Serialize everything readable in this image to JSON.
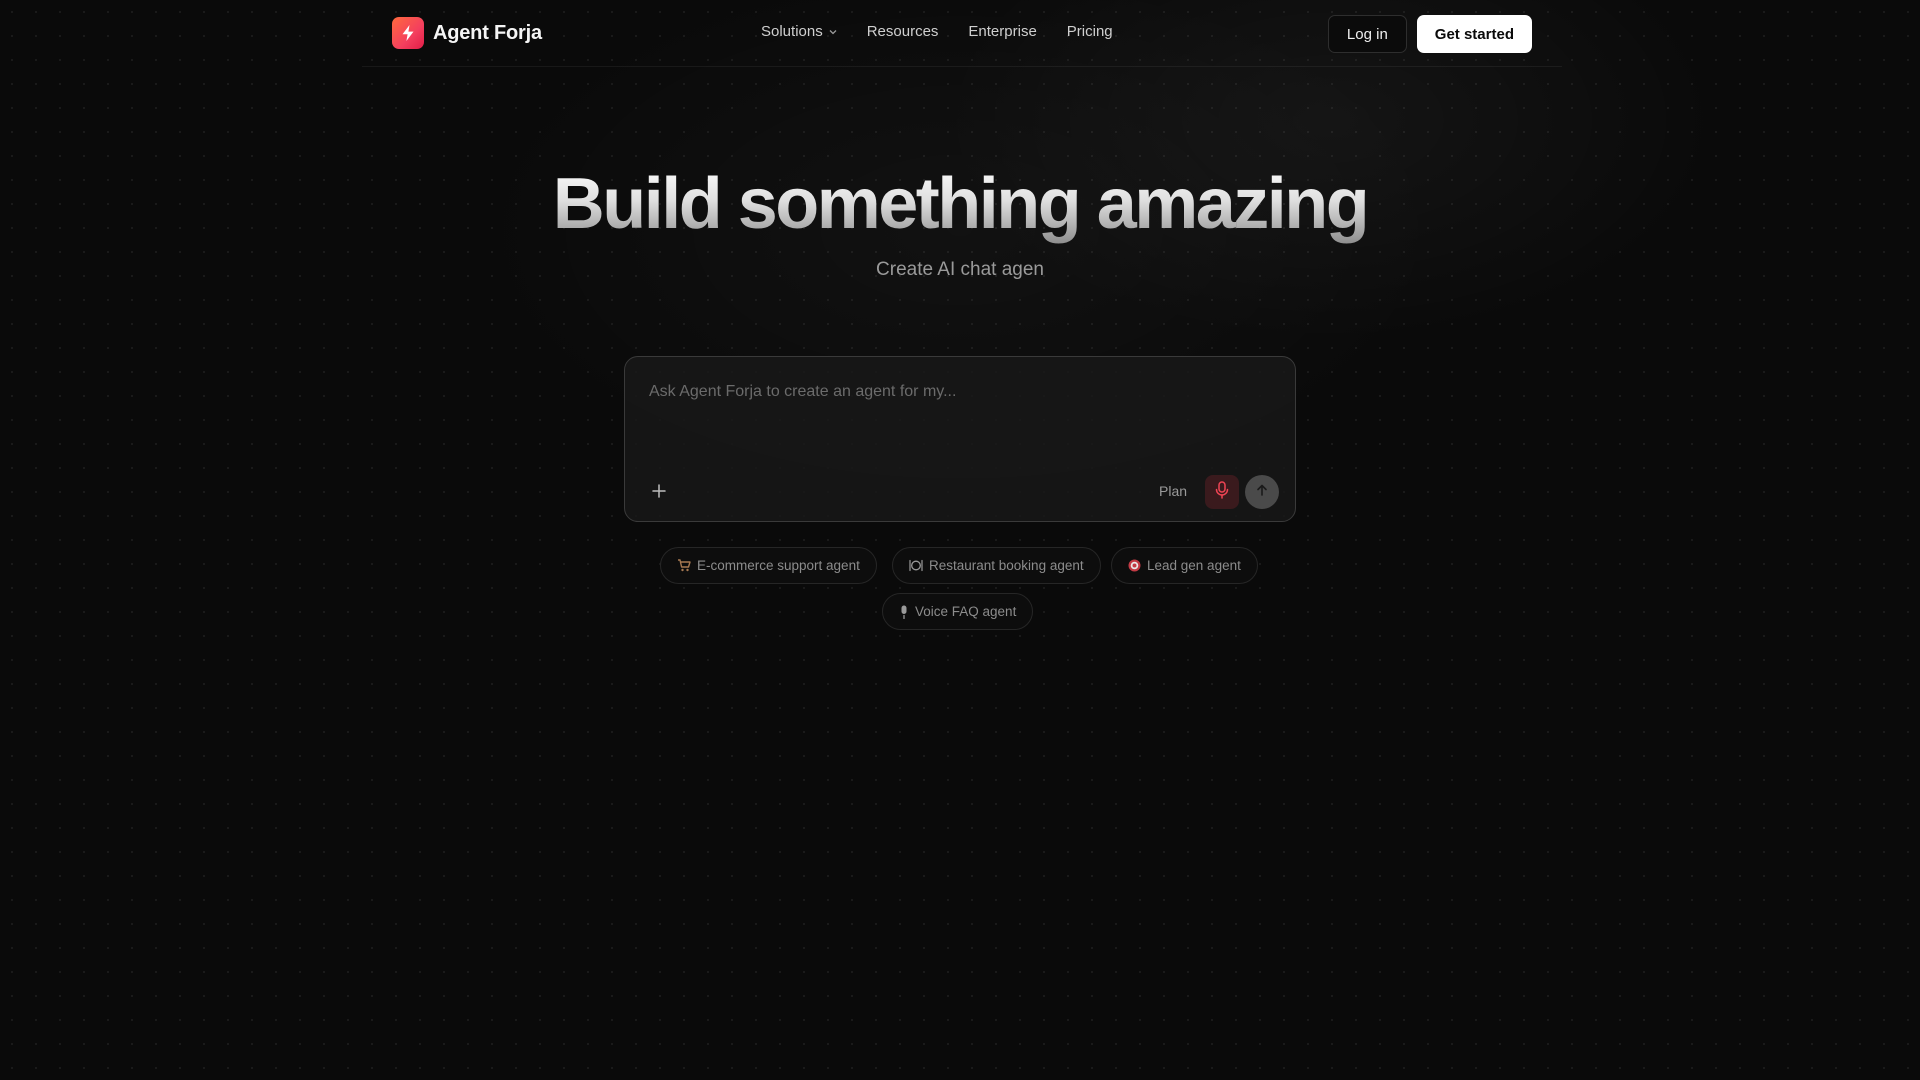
{
  "brand": {
    "name": "Agent Forja",
    "accent": "#f43f5e"
  },
  "nav": {
    "items": [
      {
        "label": "Solutions",
        "has_dropdown": true
      },
      {
        "label": "Resources"
      },
      {
        "label": "Enterprise"
      },
      {
        "label": "Pricing"
      }
    ]
  },
  "header_actions": {
    "login_label": "Log in",
    "signup_label": "Get started"
  },
  "hero": {
    "title": "Build something amazing",
    "subtitle": "Create AI chat agen"
  },
  "prompt": {
    "placeholder": "Ask Agent Forja to create an agent for my...",
    "plan_label": "Plan",
    "icons": {
      "add": "plus-icon",
      "voice": "microphone-icon",
      "submit": "arrow-up-icon"
    }
  },
  "suggestions": [
    {
      "label": "E-commerce support agent",
      "icon": "shopping-cart-icon"
    },
    {
      "label": "Restaurant booking agent",
      "icon": "plate-cutlery-icon"
    },
    {
      "label": "Lead gen agent",
      "icon": "target-icon"
    },
    {
      "label": "Voice FAQ agent",
      "icon": "microphone-icon"
    }
  ]
}
